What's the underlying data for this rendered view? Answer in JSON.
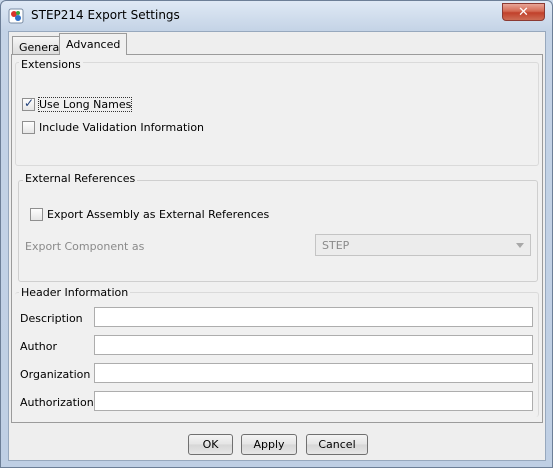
{
  "window": {
    "title": "STEP214 Export Settings",
    "close_glyph": "✕"
  },
  "tabs": [
    {
      "label": "General"
    },
    {
      "label": "Advanced"
    }
  ],
  "extensions": {
    "title": "Extensions",
    "use_long_names": {
      "label": "Use Long Names",
      "checked": true
    },
    "include_validation": {
      "label": "Include Validation Information",
      "checked": false
    }
  },
  "external_references": {
    "title": "External References",
    "export_assembly": {
      "label": "Export Assembly as External References",
      "checked": false
    },
    "export_component_label": "Export Component as",
    "export_component_value": "STEP"
  },
  "header_information": {
    "title": "Header Information",
    "fields": [
      {
        "label": "Description",
        "value": ""
      },
      {
        "label": "Author",
        "value": ""
      },
      {
        "label": "Organization",
        "value": ""
      },
      {
        "label": "Authorization",
        "value": ""
      }
    ]
  },
  "buttons": {
    "ok": "OK",
    "apply": "Apply",
    "cancel": "Cancel"
  }
}
